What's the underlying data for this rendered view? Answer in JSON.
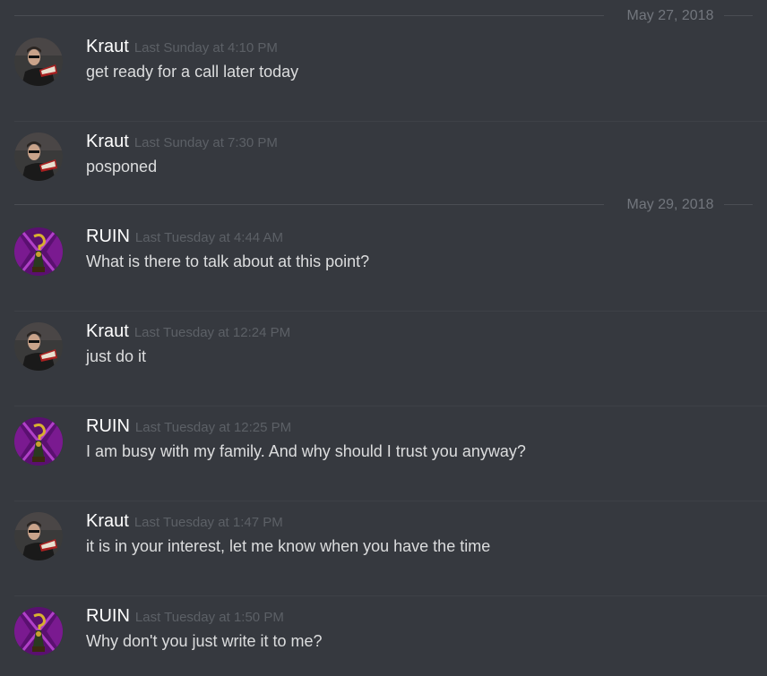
{
  "dividers": [
    {
      "label": "May 27, 2018"
    },
    {
      "label": "May 29, 2018"
    }
  ],
  "messages": [
    {
      "author": "Kraut",
      "timestamp": "Last Sunday at 4:10 PM",
      "text": "get ready for a call later today",
      "avatar": "kraut-avatar"
    },
    {
      "author": "Kraut",
      "timestamp": "Last Sunday at 7:30 PM",
      "text": "posponed",
      "avatar": "kraut-avatar"
    },
    {
      "author": "RUIN",
      "timestamp": "Last Tuesday at 4:44 AM",
      "text": "What is there to talk about at this point?",
      "avatar": "ruin-avatar"
    },
    {
      "author": "Kraut",
      "timestamp": "Last Tuesday at 12:24 PM",
      "text": "just do it",
      "avatar": "kraut-avatar"
    },
    {
      "author": "RUIN",
      "timestamp": "Last Tuesday at 12:25 PM",
      "text": "I am busy with my family. And why should I trust you anyway?",
      "avatar": "ruin-avatar"
    },
    {
      "author": "Kraut",
      "timestamp": "Last Tuesday at 1:47 PM",
      "text": "it is in your interest, let me know when you have the time",
      "avatar": "kraut-avatar"
    },
    {
      "author": "RUIN",
      "timestamp": "Last Tuesday at 1:50 PM",
      "text": "Why don't you just write it to me?",
      "avatar": "ruin-avatar"
    }
  ],
  "colors": {
    "background": "#36393f",
    "author": "#ffffff",
    "text": "#dcddde",
    "timestamp": "#5c6066",
    "divider": "#72767d"
  }
}
